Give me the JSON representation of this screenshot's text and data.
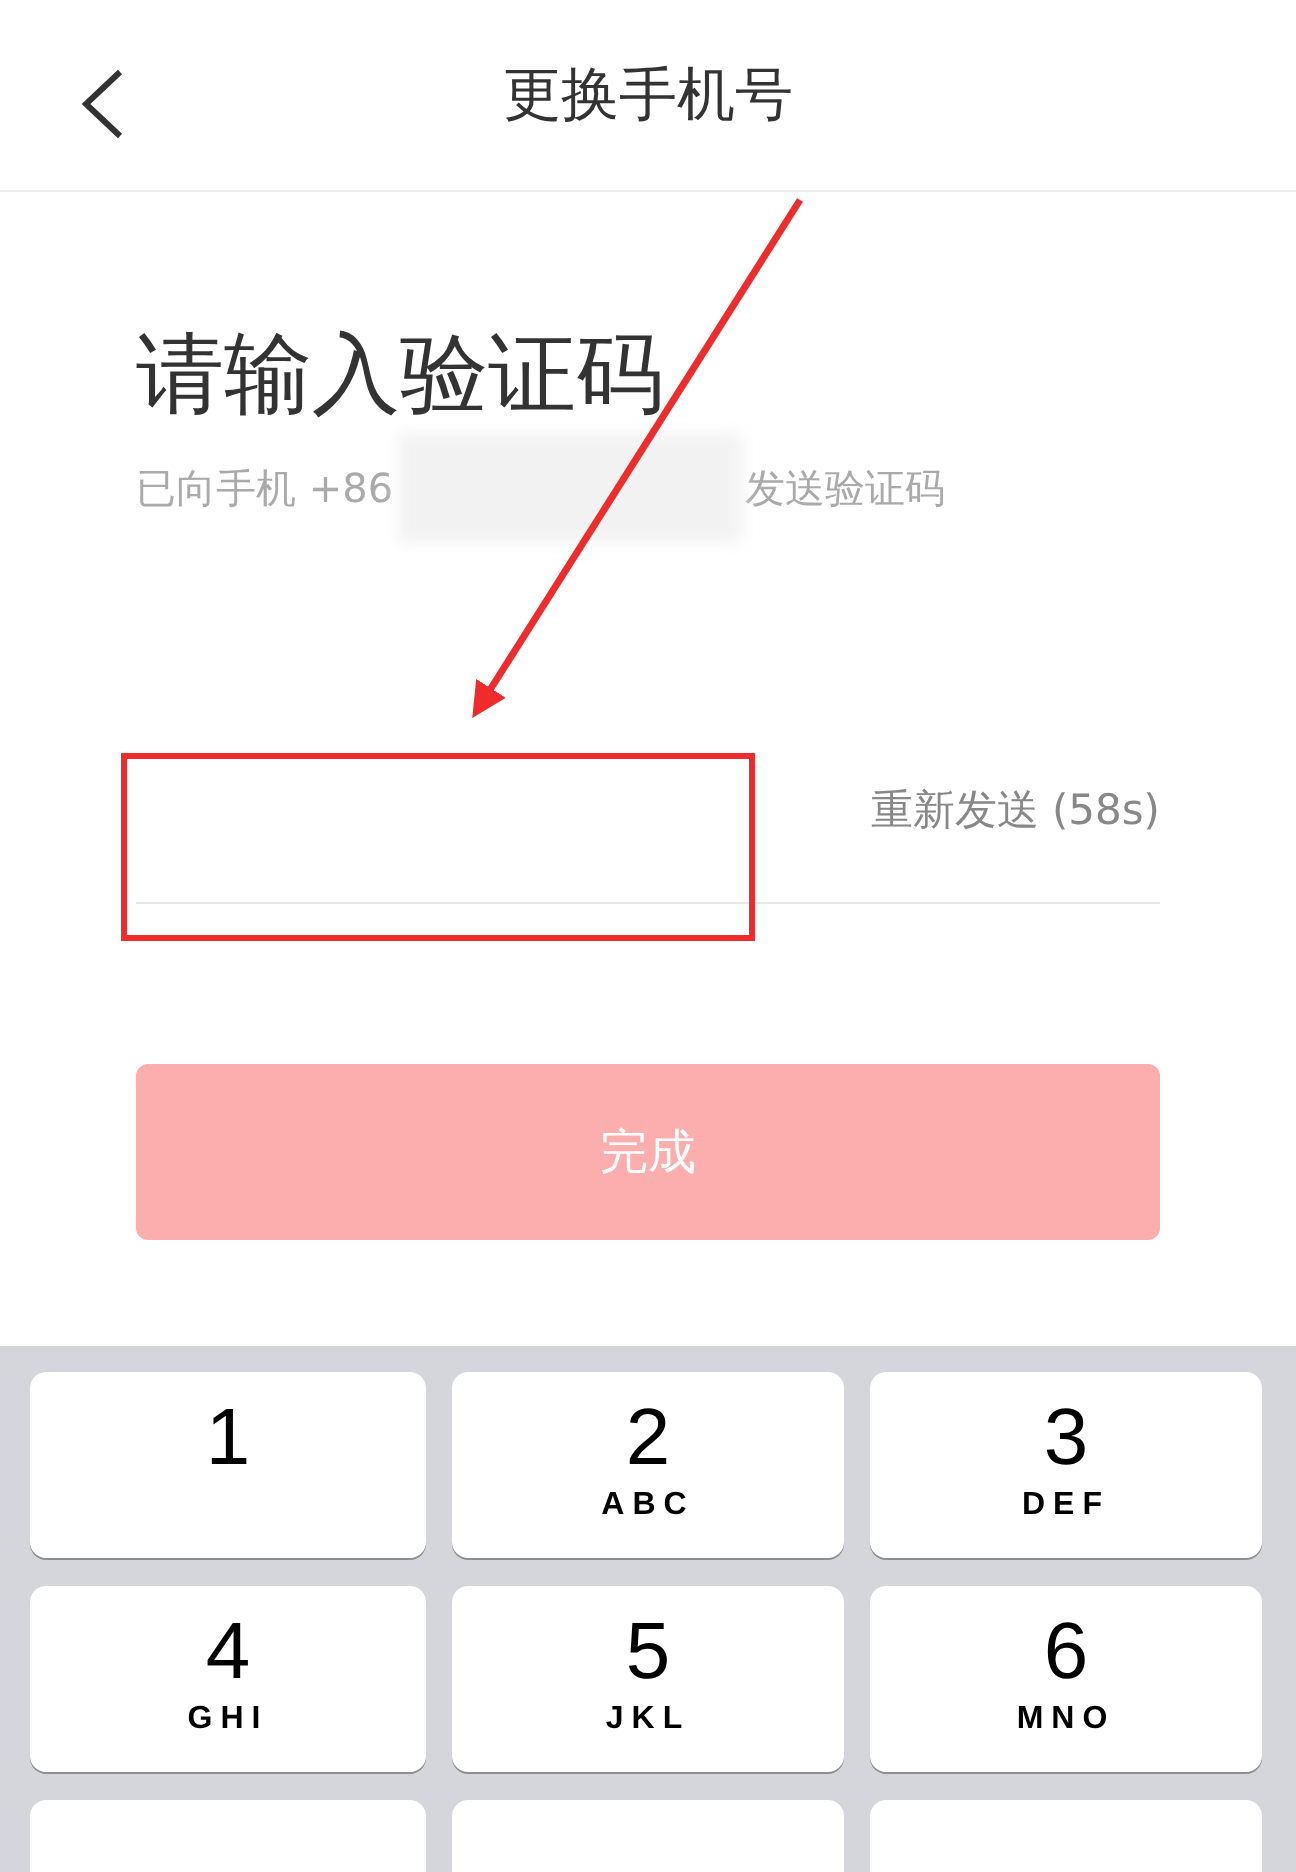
{
  "header": {
    "title": "更换手机号"
  },
  "heading": "请输入验证码",
  "sent_notice": {
    "prefix": "已向手机 +86",
    "suffix": "发送验证码"
  },
  "resend": "重新发送 (58s)",
  "submit": {
    "label": "完成",
    "disabled": true
  },
  "keypad": {
    "keys": [
      {
        "digit": "1"
      },
      {
        "digit": "2",
        "letters": "ABC"
      },
      {
        "digit": "3",
        "letters": "DEF"
      },
      {
        "digit": "4",
        "letters": "GHI"
      },
      {
        "digit": "5",
        "letters": "JKL"
      },
      {
        "digit": "6",
        "letters": "MNO"
      }
    ]
  }
}
